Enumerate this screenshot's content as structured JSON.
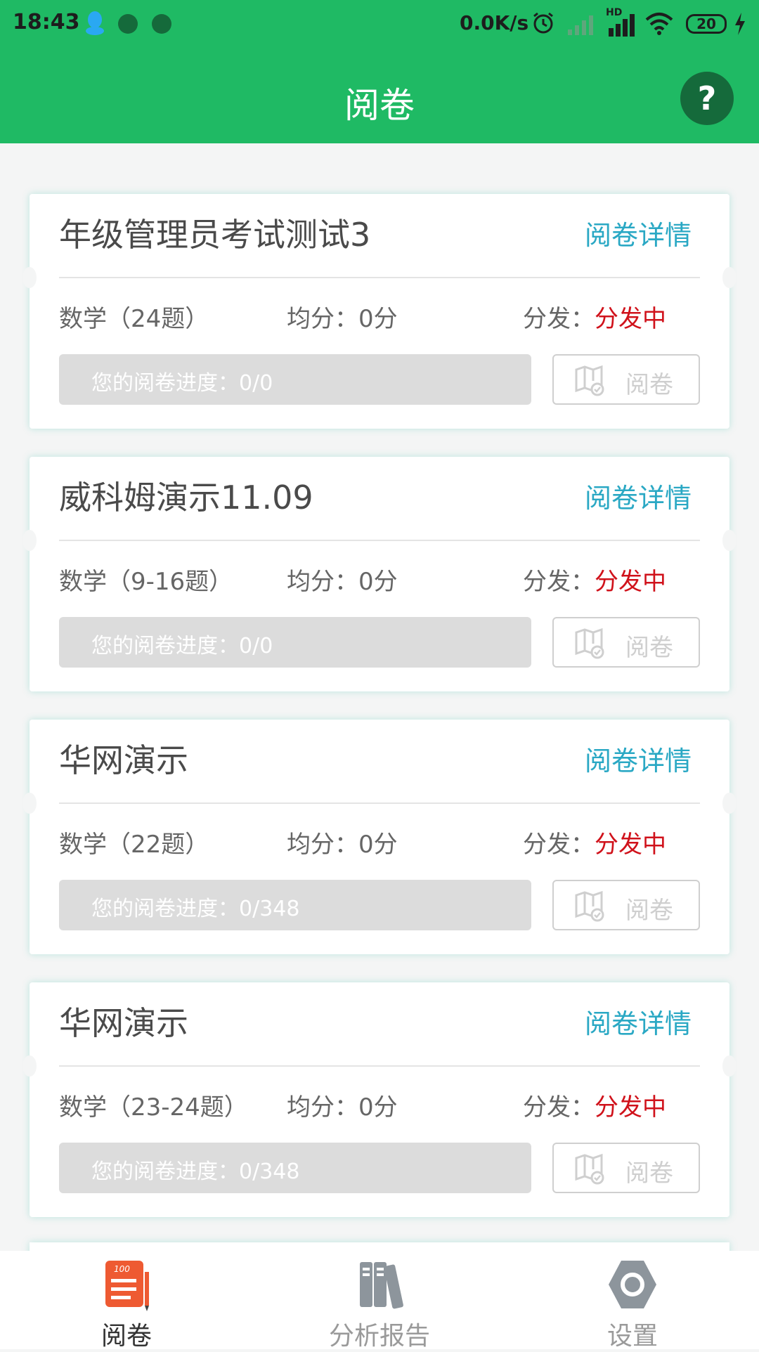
{
  "status_bar": {
    "time": "18:43",
    "net_speed": "0.0K/s",
    "hd": "HD",
    "battery": "20"
  },
  "header": {
    "title": "阅卷",
    "help_label": "?"
  },
  "cards": [
    {
      "title": "年级管理员考试测试3",
      "detail_link": "阅卷详情",
      "subject": "数学（24题）",
      "avg_label": "均分：0分",
      "dist_label": "分发：",
      "dist_status": "分发中",
      "progress_text": "您的阅卷进度：0/0",
      "grade_button": "阅卷"
    },
    {
      "title": "威科姆演示11.09",
      "detail_link": "阅卷详情",
      "subject": "数学（9-16题）",
      "avg_label": "均分：0分",
      "dist_label": "分发：",
      "dist_status": "分发中",
      "progress_text": "您的阅卷进度：0/0",
      "grade_button": "阅卷"
    },
    {
      "title": "华网演示",
      "detail_link": "阅卷详情",
      "subject": "数学（22题）",
      "avg_label": "均分：0分",
      "dist_label": "分发：",
      "dist_status": "分发中",
      "progress_text": "您的阅卷进度：0/348",
      "grade_button": "阅卷"
    },
    {
      "title": "华网演示",
      "detail_link": "阅卷详情",
      "subject": "数学（23-24题）",
      "avg_label": "均分：0分",
      "dist_label": "分发：",
      "dist_status": "分发中",
      "progress_text": "您的阅卷进度：0/348",
      "grade_button": "阅卷"
    }
  ],
  "tabs": [
    {
      "label": "阅卷",
      "icon": "paper-icon",
      "active": true
    },
    {
      "label": "分析报告",
      "icon": "books-icon",
      "active": false
    },
    {
      "label": "设置",
      "icon": "settings-icon",
      "active": false
    }
  ],
  "colors": {
    "brand_green": "#1fba64",
    "dark_green": "#156a3b",
    "link_blue": "#2aa8c4",
    "status_red": "#d0121b",
    "tab_active": "#333333",
    "tab_inactive": "#9a9a9a",
    "tab_icon_active": "#ee5a32"
  }
}
